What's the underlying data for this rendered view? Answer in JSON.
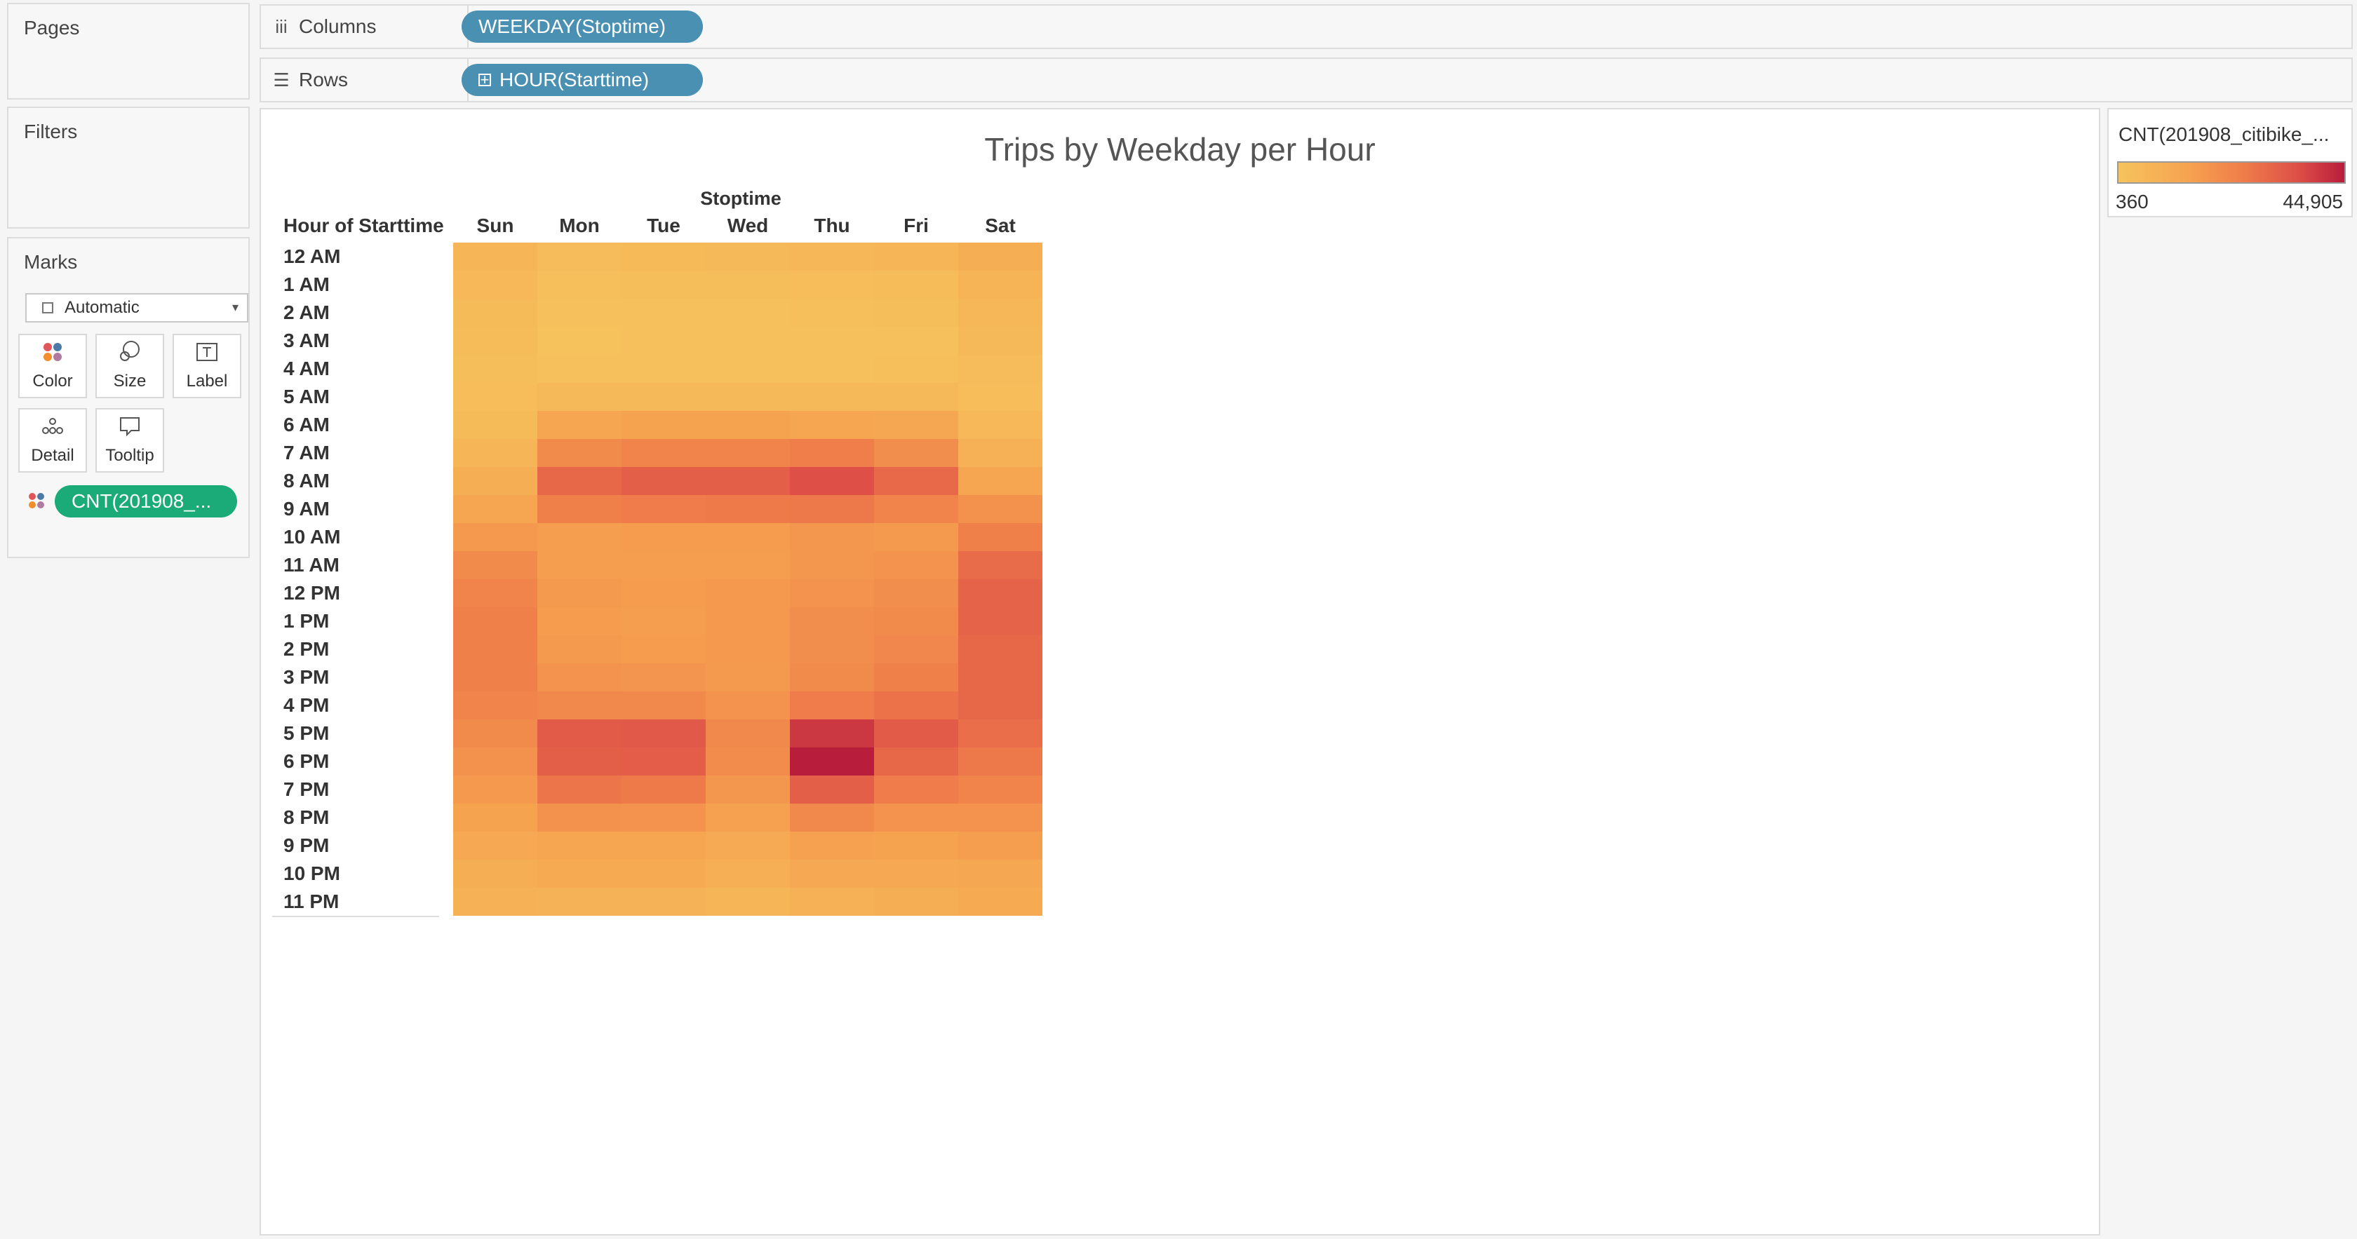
{
  "panels": {
    "pages": "Pages",
    "filters": "Filters",
    "marks": "Marks"
  },
  "shelves": {
    "columns": {
      "label": "Columns",
      "pill": "WEEKDAY(Stoptime)"
    },
    "rows": {
      "label": "Rows",
      "pill": "HOUR(Starttime)"
    }
  },
  "marks": {
    "type": "Automatic",
    "buttons": {
      "color": "Color",
      "size": "Size",
      "label": "Label",
      "detail": "Detail",
      "tooltip": "Tooltip"
    },
    "color_pill": "CNT(201908_..."
  },
  "legend": {
    "title": "CNT(201908_citibike_...",
    "min": "360",
    "max": "44,905"
  },
  "colors": {
    "scale_low": "#f6c35d",
    "scale_high": "#b81d3b",
    "pill_blue": "#4a90b2",
    "pill_green": "#1aab78"
  },
  "chart_data": {
    "type": "heatmap",
    "title": "Trips by Weekday per Hour",
    "column_title": "Stoptime",
    "row_header": "Hour of Starttime",
    "columns": [
      "Sun",
      "Mon",
      "Tue",
      "Wed",
      "Thu",
      "Fri",
      "Sat"
    ],
    "rows": [
      "12 AM",
      "1 AM",
      "2 AM",
      "3 AM",
      "4 AM",
      "5 AM",
      "6 AM",
      "7 AM",
      "8 AM",
      "9 AM",
      "10 AM",
      "11 AM",
      "12 PM",
      "1 PM",
      "2 PM",
      "3 PM",
      "4 PM",
      "5 PM",
      "6 PM",
      "7 PM",
      "8 PM",
      "9 PM",
      "10 PM",
      "11 PM"
    ],
    "color_range": [
      360,
      44905
    ],
    "values": [
      [
        6500,
        3800,
        4200,
        4800,
        5500,
        6000,
        9500
      ],
      [
        5000,
        2000,
        2300,
        2600,
        3000,
        3500,
        7000
      ],
      [
        4000,
        1500,
        1600,
        1800,
        2200,
        2600,
        5500
      ],
      [
        3200,
        1000,
        1100,
        1200,
        1500,
        1800,
        4500
      ],
      [
        2800,
        1400,
        1400,
        1500,
        1700,
        1900,
        3600
      ],
      [
        3000,
        4500,
        4800,
        4800,
        4700,
        4500,
        3000
      ],
      [
        4000,
        13000,
        14000,
        14000,
        13500,
        12500,
        5000
      ],
      [
        6500,
        21000,
        23000,
        23000,
        24500,
        20000,
        8000
      ],
      [
        9500,
        30000,
        32000,
        32000,
        35500,
        29500,
        13000
      ],
      [
        13500,
        24000,
        25000,
        25500,
        26000,
        23000,
        19000
      ],
      [
        17000,
        15500,
        16000,
        16000,
        17500,
        16500,
        24000
      ],
      [
        21000,
        15500,
        15500,
        15500,
        17500,
        18500,
        29000
      ],
      [
        23000,
        16500,
        16000,
        17000,
        18500,
        20000,
        31000
      ],
      [
        24000,
        16000,
        15500,
        17000,
        20000,
        21000,
        31000
      ],
      [
        24000,
        16500,
        16000,
        17000,
        20000,
        22000,
        30000
      ],
      [
        24000,
        18500,
        18000,
        16500,
        21000,
        24000,
        30000
      ],
      [
        23000,
        21500,
        21500,
        18500,
        25000,
        27500,
        30000
      ],
      [
        21000,
        33000,
        33500,
        21500,
        40000,
        33000,
        28500
      ],
      [
        19000,
        32000,
        32500,
        20500,
        44905,
        30000,
        26000
      ],
      [
        17000,
        26500,
        25500,
        17500,
        32000,
        25000,
        23000
      ],
      [
        14000,
        19000,
        18500,
        14500,
        21500,
        18500,
        18500
      ],
      [
        11500,
        13500,
        13500,
        11000,
        14500,
        14000,
        15500
      ],
      [
        9500,
        10500,
        10500,
        9000,
        11500,
        12000,
        12500
      ],
      [
        8000,
        7500,
        7500,
        6500,
        8500,
        9500,
        10500
      ]
    ]
  }
}
